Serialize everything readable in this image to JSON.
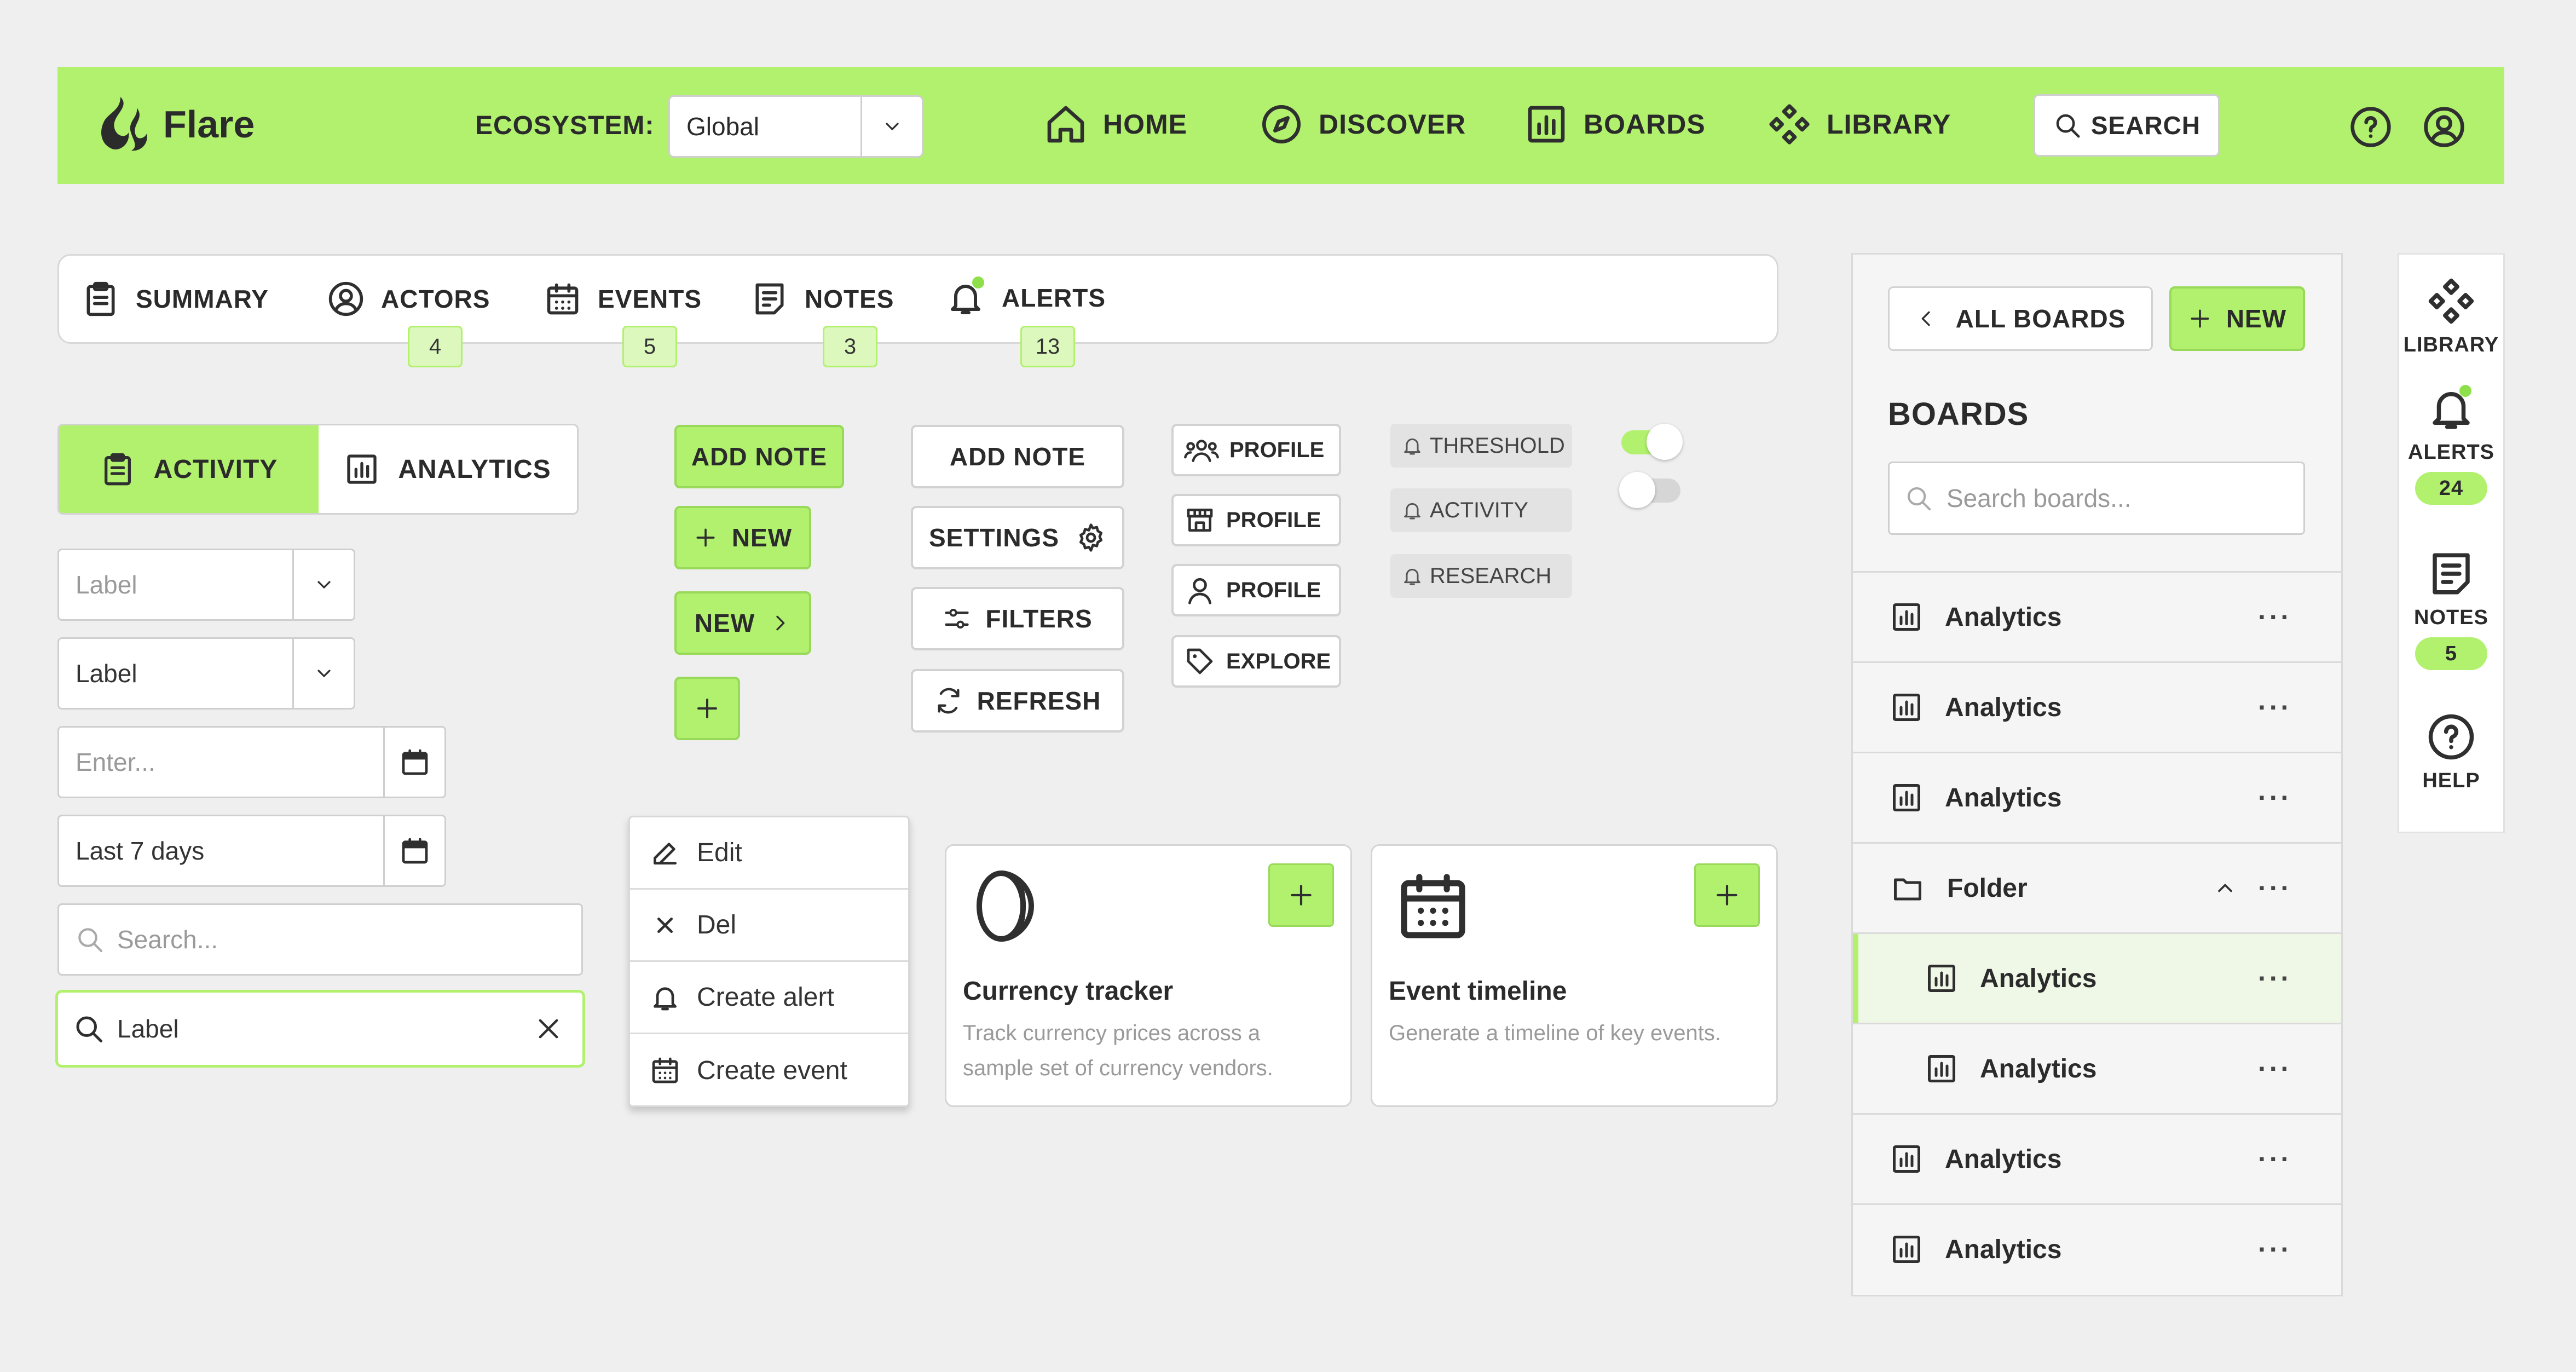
{
  "brand": {
    "name": "Flare",
    "accent": "#b1f16e"
  },
  "topbar": {
    "ecosystem_label": "ECOSYSTEM:",
    "ecosystem_value": "Global",
    "nav": [
      {
        "label": "HOME",
        "icon": "home-icon"
      },
      {
        "label": "DISCOVER",
        "icon": "compass-icon"
      },
      {
        "label": "BOARDS",
        "icon": "bar-chart-icon"
      },
      {
        "label": "LIBRARY",
        "icon": "diamond-grid-icon"
      }
    ],
    "search_label": "SEARCH"
  },
  "tabs": [
    {
      "label": "SUMMARY",
      "icon": "clipboard-icon"
    },
    {
      "label": "ACTORS",
      "icon": "user-circle-icon",
      "count": "4"
    },
    {
      "label": "EVENTS",
      "icon": "calendar-icon",
      "count": "5"
    },
    {
      "label": "NOTES",
      "icon": "note-icon",
      "count": "3"
    },
    {
      "label": "ALERTS",
      "icon": "bell-icon",
      "count": "13"
    }
  ],
  "segmented": {
    "active": "ACTIVITY",
    "inactive": "ANALYTICS"
  },
  "form": {
    "select1_placeholder": "Label",
    "select2_value": "Label",
    "date1_placeholder": "Enter...",
    "date2_value": "Last 7 days",
    "search_placeholder": "Search...",
    "search_active_value": "Label"
  },
  "green_buttons": {
    "add_note": "ADD NOTE",
    "new": "NEW",
    "new_arrow": "NEW"
  },
  "outline_buttons": {
    "add_note": "ADD NOTE",
    "settings": "SETTINGS",
    "filters": "FILTERS",
    "refresh": "REFRESH"
  },
  "small_buttons": [
    "PROFILE",
    "PROFILE",
    "PROFILE",
    "EXPLORE"
  ],
  "chips": [
    "THRESHOLD",
    "ACTIVITY",
    "RESEARCH"
  ],
  "context_menu": [
    "Edit",
    "Del",
    "Create alert",
    "Create event"
  ],
  "cards": [
    {
      "title": "Currency tracker",
      "desc": "Track currency prices across a sample set of currency vendors."
    },
    {
      "title": "Event timeline",
      "desc": "Generate a timeline of key events."
    }
  ],
  "boards_panel": {
    "back_label": "ALL BOARDS",
    "new_label": "NEW",
    "title": "BOARDS",
    "search_placeholder": "Search boards...",
    "rows": [
      {
        "label": "Analytics",
        "type": "board"
      },
      {
        "label": "Analytics",
        "type": "board"
      },
      {
        "label": "Analytics",
        "type": "board"
      },
      {
        "label": "Folder",
        "type": "folder"
      },
      {
        "label": "Analytics",
        "type": "child-selected"
      },
      {
        "label": "Analytics",
        "type": "child"
      },
      {
        "label": "Analytics",
        "type": "board"
      },
      {
        "label": "Analytics",
        "type": "board"
      }
    ]
  },
  "rail": {
    "library": "LIBRARY",
    "alerts": "ALERTS",
    "alerts_count": "24",
    "notes": "NOTES",
    "notes_count": "5",
    "help": "HELP"
  }
}
